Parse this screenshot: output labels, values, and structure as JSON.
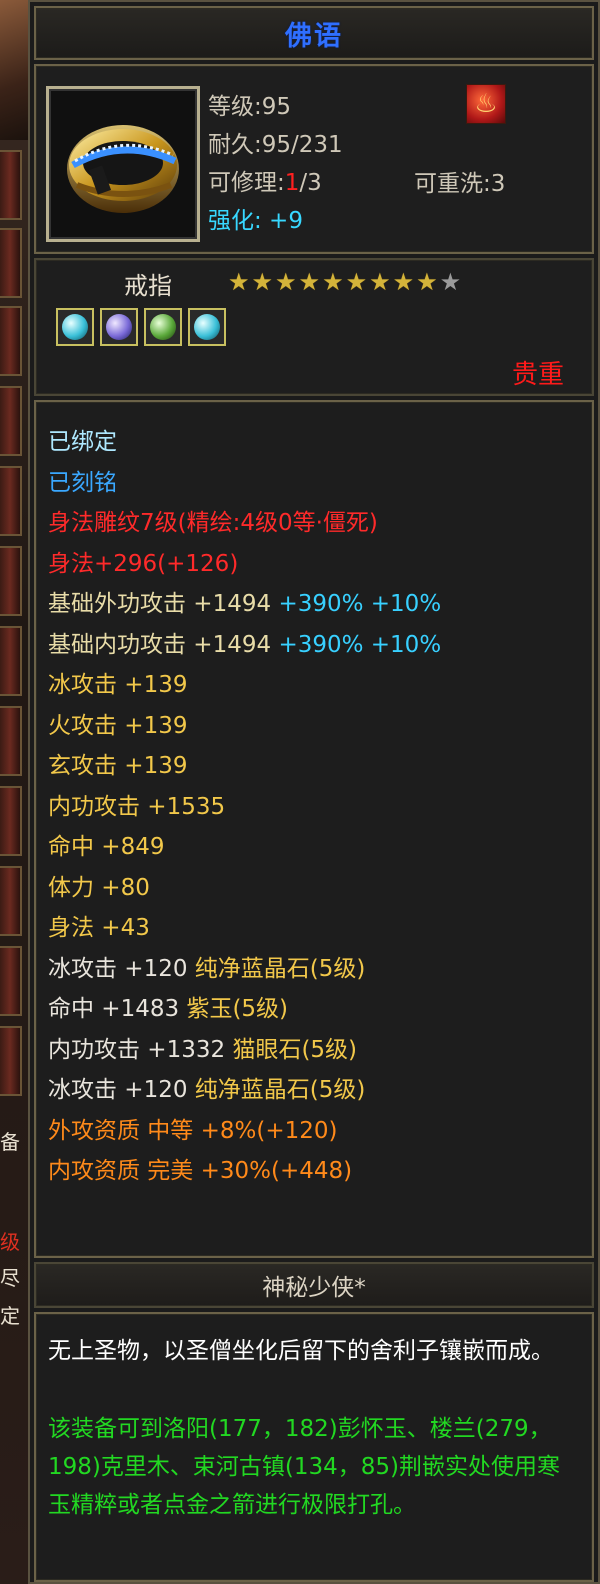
{
  "tooltip": {
    "title": "佛语",
    "level": "等级:95",
    "durability": "耐久:95/231",
    "repair_prefix": "可修理:",
    "repair_current": "1",
    "repair_suffix": "/3",
    "rewash": "可重洗:3",
    "enhance": "强化: +9",
    "item_type": "戒指",
    "stars_filled": 9,
    "stars_total": 10,
    "rarity": "贵重",
    "attributes": [
      {
        "text": "已绑定",
        "color": "ltblue"
      },
      {
        "text": "已刻铭",
        "color": "blue"
      },
      {
        "text": "身法雕纹7级(精绘:4级0等·僵死)",
        "color": "red"
      },
      {
        "text": "身法+296(+126)",
        "color": "red"
      },
      {
        "parts": [
          {
            "text": "基础外功攻击 +1494 ",
            "color": "gold"
          },
          {
            "text": "+390% +10%",
            "color": "cyan"
          }
        ]
      },
      {
        "parts": [
          {
            "text": "基础内功攻击 +1494 ",
            "color": "gold"
          },
          {
            "text": "+390% +10%",
            "color": "cyan"
          }
        ]
      },
      {
        "text": "冰攻击 +139",
        "color": "yellow"
      },
      {
        "text": "火攻击 +139",
        "color": "yellow"
      },
      {
        "text": "玄攻击 +139",
        "color": "yellow"
      },
      {
        "text": "内功攻击 +1535",
        "color": "yellow"
      },
      {
        "text": "命中 +849",
        "color": "yellow"
      },
      {
        "text": "体力 +80",
        "color": "yellow"
      },
      {
        "text": "身法 +43",
        "color": "yellow"
      },
      {
        "parts": [
          {
            "text": "冰攻击 +120 ",
            "color": "white"
          },
          {
            "text": "纯净蓝晶石(5级)",
            "color": "yellow"
          }
        ]
      },
      {
        "parts": [
          {
            "text": "命中 +1483 ",
            "color": "white"
          },
          {
            "text": "紫玉(5级)",
            "color": "yellow"
          }
        ]
      },
      {
        "parts": [
          {
            "text": "内功攻击 +1332 ",
            "color": "white"
          },
          {
            "text": "猫眼石(5级)",
            "color": "yellow"
          }
        ]
      },
      {
        "parts": [
          {
            "text": "冰攻击 +120 ",
            "color": "white"
          },
          {
            "text": "纯净蓝晶石(5级)",
            "color": "yellow"
          }
        ]
      },
      {
        "text": "外攻资质  中等 +8%(+120)",
        "color": "orange"
      },
      {
        "text": "内攻资质  完美 +30%(+448)",
        "color": "orange"
      }
    ],
    "maker": "神秘少侠*",
    "description": "无上圣物，以圣僧坐化后留下的舍利子镶嵌而成。",
    "hint": "该装备可到洛阳(177，182)彭怀玉、楼兰(279，198)克里木、束河古镇(134，85)荆嵌实处使用寒玉精粹或者点金之箭进行极限打孔。"
  },
  "gems": [
    "teal",
    "violet",
    "green",
    "teal"
  ],
  "colors": {
    "title": "#2f6fff",
    "rarity": "#ff1a1a",
    "enhance": "#38d8ff"
  },
  "background": {
    "chars": [
      "备",
      "级",
      "尽",
      "定"
    ]
  }
}
